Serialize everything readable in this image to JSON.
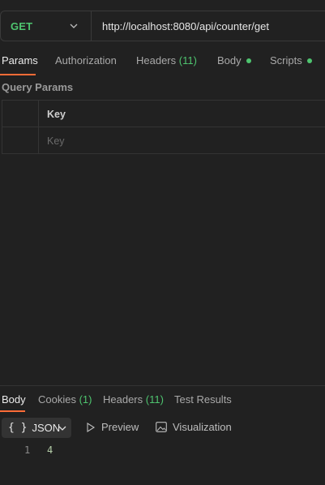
{
  "request": {
    "method": "GET",
    "url": "http://localhost:8080/api/counter/get"
  },
  "request_tabs": {
    "params": "Params",
    "authorization": "Authorization",
    "headers": "Headers",
    "headers_count": "(11)",
    "body": "Body",
    "scripts": "Scripts"
  },
  "query_params": {
    "title": "Query Params",
    "key_header": "Key",
    "key_placeholder": "Key"
  },
  "response_tabs": {
    "body": "Body",
    "cookies": "Cookies",
    "cookies_count": "(1)",
    "headers": "Headers",
    "headers_count": "(11)",
    "test_results": "Test Results"
  },
  "response_format": {
    "selected": "JSON",
    "preview": "Preview",
    "visualization": "Visualization"
  },
  "response_body": {
    "line_number": "1",
    "content": "4"
  },
  "colors": {
    "accent": "#ff6c37",
    "method_green": "#4ec46f",
    "background": "#212121"
  }
}
